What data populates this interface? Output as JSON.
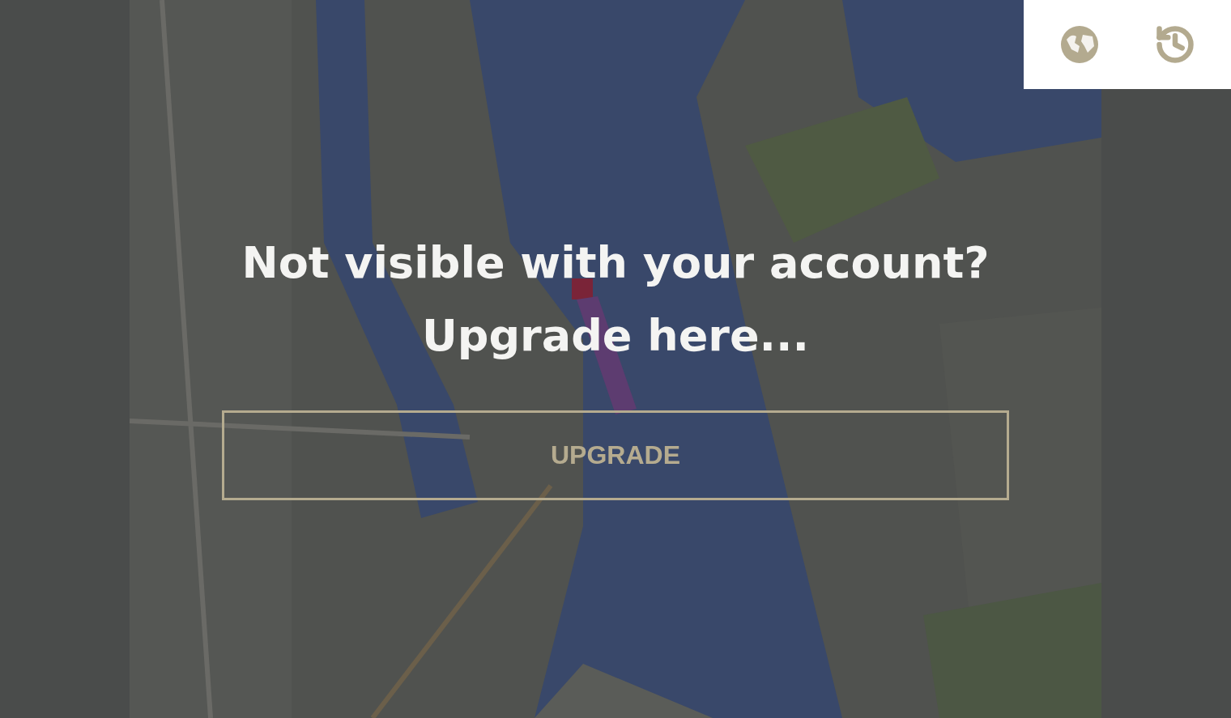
{
  "message": {
    "lines": [
      "Not visible with your account?",
      "Upgrade here..."
    ]
  },
  "upgrade_button": {
    "label": "UPGRADE"
  },
  "toolbar": {
    "buttons": [
      {
        "kind": "globe"
      },
      {
        "kind": "history"
      }
    ]
  }
}
